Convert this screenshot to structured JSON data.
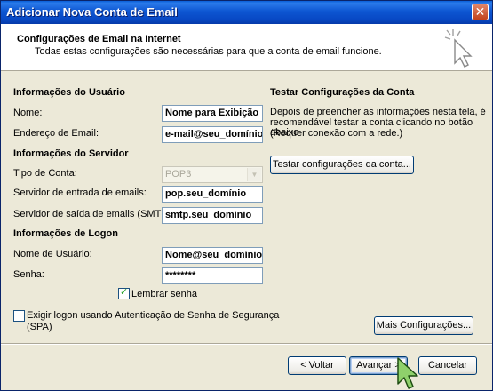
{
  "window": {
    "title": "Adicionar Nova Conta de Email",
    "close_label": "✕"
  },
  "header": {
    "title": "Configurações de Email na Internet",
    "subtitle": "Todas estas configurações são necessárias para que a conta de email funcione."
  },
  "user_info": {
    "section_label": "Informações do Usuário",
    "name_label": "Nome:",
    "name_value": "Nome para Exibição",
    "email_label": "Endereço de Email:",
    "email_value": "e-mail@seu_domínio"
  },
  "server_info": {
    "section_label": "Informações do Servidor",
    "account_type_label": "Tipo de Conta:",
    "account_type_value": "POP3",
    "incoming_label": "Servidor de entrada de emails:",
    "incoming_value": "pop.seu_domínio",
    "outgoing_label": "Servidor de saída de emails (SMTP):",
    "outgoing_value": "smtp.seu_domínio"
  },
  "logon_info": {
    "section_label": "Informações de Logon",
    "username_label": "Nome de Usuário:",
    "username_value": "Nome@seu_domínio",
    "password_label": "Senha:",
    "password_value": "********",
    "remember_label": "Lembrar senha",
    "remember_checked": true,
    "spa_label_line1": "Exigir logon usando Autenticação de Senha de Segurança",
    "spa_label_line2": "(SPA)",
    "spa_checked": false
  },
  "test": {
    "section_label": "Testar Configurações da Conta",
    "desc_line1": "Depois de preencher as informações nesta tela, é",
    "desc_line2": "recomendável testar a conta clicando no botão abaixo",
    "desc_line3": "(Requer conexão com a rede.)",
    "test_button": "Testar configurações da conta..."
  },
  "more_settings_button": "Mais Configurações...",
  "footer": {
    "back_button": "< Voltar",
    "next_button": "Avançar >",
    "cancel_button": "Cancelar"
  },
  "icons": {
    "header_logo": "cursor-sparkle-icon",
    "mouse_pointer": "mouse-pointer-icon"
  }
}
